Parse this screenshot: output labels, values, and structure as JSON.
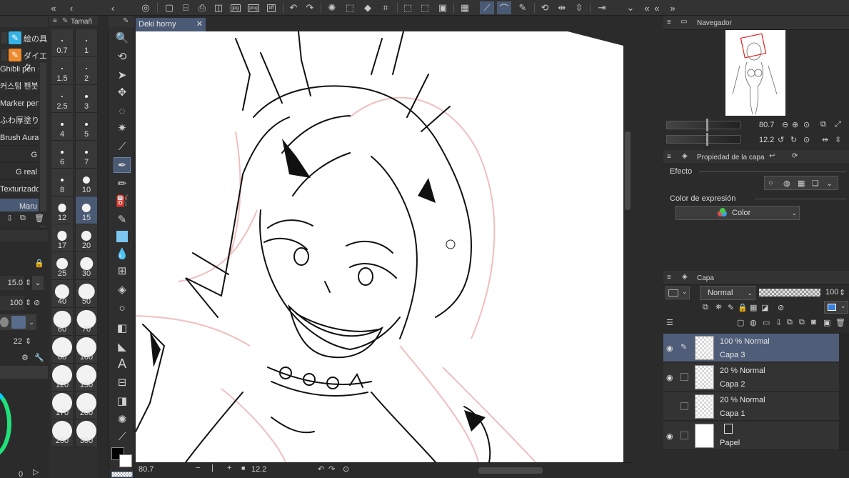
{
  "document": {
    "tab_title": "Deki horny",
    "zoom": "80.7",
    "rotation": "12.2"
  },
  "left_panel": {
    "size_tab_label": "Tamañ",
    "top_brushes": [
      "絵の具",
      "ダイエク"
    ],
    "brushes": [
      "Ghibli pen +",
      "커스텀 펜붓",
      "Marker pencil",
      "ふわ厚塗り",
      "Brush Aura",
      "G",
      "G real",
      "Texturizado",
      "Maru"
    ],
    "brush_size_value": "15.0",
    "opacity_value": "100",
    "hardness_value": "22",
    "bottom_value": "0"
  },
  "size_panel": {
    "sizes": [
      "0.7",
      "1",
      "1.5",
      "2",
      "2.5",
      "3",
      "4",
      "5",
      "6",
      "7",
      "8",
      "10",
      "12",
      "15",
      "17",
      "20",
      "25",
      "30",
      "40",
      "50",
      "60",
      "70",
      "80",
      "100",
      "120",
      "150",
      "170",
      "200",
      "250",
      "300"
    ],
    "selected": "15"
  },
  "navigator": {
    "title": "Navegador",
    "zoom": "80.7",
    "rotation": "12.2"
  },
  "layer_property": {
    "title": "Propiedad de la capa",
    "effect_label": "Efecto",
    "expression_color_label": "Color de expresión",
    "expression_color_value": "Color"
  },
  "layers_panel": {
    "title": "Capa",
    "blend_mode": "Normal",
    "opacity": "100",
    "layers": [
      {
        "mode": "100 % Normal",
        "name": "Capa 3",
        "selected": true,
        "visible": true
      },
      {
        "mode": "20 % Normal",
        "name": "Capa 2",
        "selected": false,
        "visible": true
      },
      {
        "mode": "20 % Normal",
        "name": "Capa 1",
        "selected": false,
        "visible": false
      },
      {
        "mode": "",
        "name": "Papel",
        "selected": false,
        "visible": true
      }
    ]
  },
  "colors": {
    "accent": "#4a5a74",
    "panel_bg": "#2b2b2b",
    "canvas_bg": "#ffffff",
    "selected_layer": "#4f5d79"
  }
}
